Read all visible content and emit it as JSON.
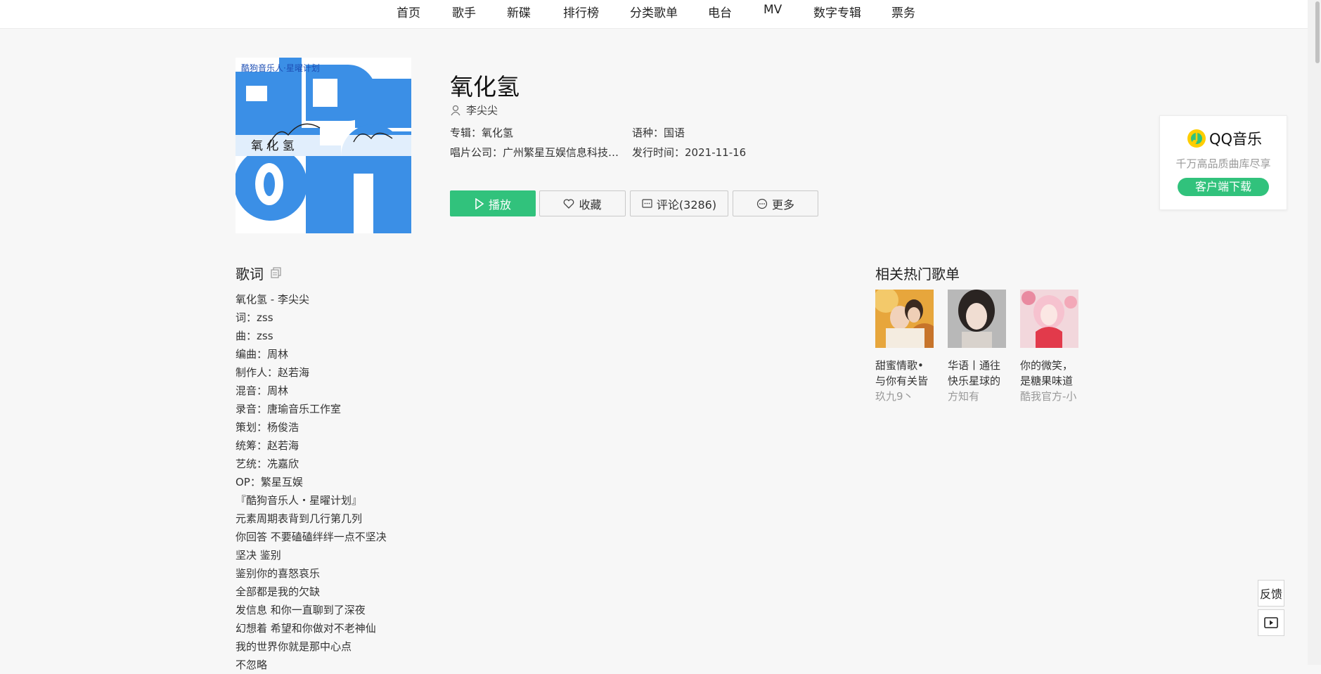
{
  "nav": {
    "items": [
      "首页",
      "歌手",
      "新碟",
      "排行榜",
      "分类歌单",
      "电台",
      "MV",
      "数字专辑",
      "票务"
    ]
  },
  "cover": {
    "caption": "酷狗音乐人·星曜计划",
    "art_text": "氧 化 氢"
  },
  "song": {
    "title": "氧化氢",
    "singer": "李尖尖",
    "album_label": "专辑：",
    "album": "氧化氢",
    "language_label": "语种：",
    "language": "国语",
    "company_label": "唱片公司：",
    "company": "广州繁星互娱信息科技有限公司",
    "release_label": "发行时间：",
    "release": "2021-11-16"
  },
  "actions": {
    "play": "播放",
    "favorite": "收藏",
    "comment": "评论(3286)",
    "more": "更多"
  },
  "lyrics": {
    "title": "歌词",
    "lines": [
      "氧化氢 - 李尖尖",
      "词：zss",
      "曲：zss",
      "编曲：周林",
      "制作人：赵若海",
      "混音：周林",
      "录音：唐瑜音乐工作室",
      "策划：杨俊浩",
      "统筹：赵若海",
      "艺统：冼嘉欣",
      "OP：繁星互娱",
      "『酷狗音乐人・星曜计划』",
      "元素周期表背到几行第几列",
      "你回答 不要磕磕绊绊一点不坚决",
      "坚决 鉴别",
      "鉴别你的喜怒哀乐",
      "全部都是我的欠缺",
      "发信息 和你一直聊到了深夜",
      "幻想着 希望和你做对不老神仙",
      "我的世界你就是那中心点",
      "不忽略"
    ]
  },
  "related": {
    "title": "相关热门歌单",
    "playlists": [
      {
        "name": "甜蜜情歌•与你有关皆是浪漫",
        "creator": "玖九9丶"
      },
      {
        "name": "华语丨通往快乐星球的方向",
        "creator": "方知有"
      },
      {
        "name": "你的微笑，是糖果味道",
        "creator": "酷我官方-小"
      }
    ]
  },
  "qq": {
    "brand": "QQ音乐",
    "slogan": "千万高品质曲库尽享",
    "download": "客户端下载"
  },
  "side": {
    "feedback": "反馈"
  },
  "colors": {
    "accent": "#31c27c",
    "cover_blue": "#3b8fe6"
  }
}
